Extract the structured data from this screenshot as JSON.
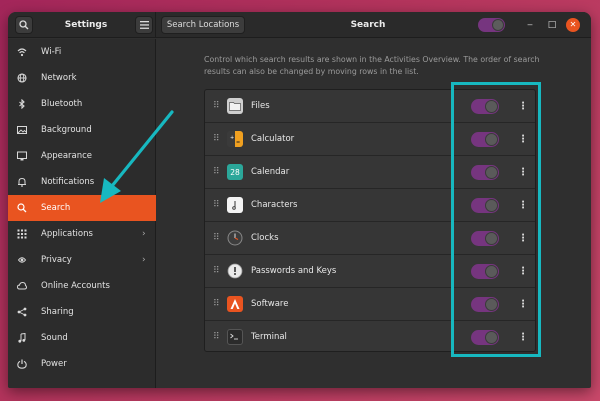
{
  "header": {
    "settings_title": "Settings",
    "search_locations_label": "Search Locations",
    "page_title": "Search",
    "master_switch_on": true,
    "search_icon": "search-icon",
    "menu_icon": "hamburger-menu-icon"
  },
  "sidebar": {
    "items": [
      {
        "label": "Wi-Fi",
        "icon": "wifi-icon",
        "active": false,
        "has_chevron": false
      },
      {
        "label": "Network",
        "icon": "network-icon",
        "active": false,
        "has_chevron": false
      },
      {
        "label": "Bluetooth",
        "icon": "bluetooth-icon",
        "active": false,
        "has_chevron": false
      },
      {
        "label": "Background",
        "icon": "background-icon",
        "active": false,
        "has_chevron": false
      },
      {
        "label": "Appearance",
        "icon": "appearance-icon",
        "active": false,
        "has_chevron": false
      },
      {
        "label": "Notifications",
        "icon": "notifications-icon",
        "active": false,
        "has_chevron": false
      },
      {
        "label": "Search",
        "icon": "search-icon",
        "active": true,
        "has_chevron": false
      },
      {
        "label": "Applications",
        "icon": "applications-icon",
        "active": false,
        "has_chevron": true
      },
      {
        "label": "Privacy",
        "icon": "privacy-icon",
        "active": false,
        "has_chevron": true
      },
      {
        "label": "Online Accounts",
        "icon": "online-accounts-icon",
        "active": false,
        "has_chevron": false
      },
      {
        "label": "Sharing",
        "icon": "sharing-icon",
        "active": false,
        "has_chevron": false
      },
      {
        "label": "Sound",
        "icon": "sound-icon",
        "active": false,
        "has_chevron": false
      },
      {
        "label": "Power",
        "icon": "power-icon",
        "active": false,
        "has_chevron": false
      }
    ]
  },
  "main": {
    "description": "Control which search results are shown in the Activities Overview. The order of search results can also be changed by moving rows in the list.",
    "providers": [
      {
        "name": "Files",
        "icon": "files-icon",
        "enabled": true
      },
      {
        "name": "Calculator",
        "icon": "calculator-icon",
        "enabled": true
      },
      {
        "name": "Calendar",
        "icon": "calendar-icon",
        "enabled": true,
        "icon_text": "28"
      },
      {
        "name": "Characters",
        "icon": "characters-icon",
        "enabled": true
      },
      {
        "name": "Clocks",
        "icon": "clocks-icon",
        "enabled": true
      },
      {
        "name": "Passwords and Keys",
        "icon": "passwords-keys-icon",
        "enabled": true
      },
      {
        "name": "Software",
        "icon": "software-icon",
        "enabled": true
      },
      {
        "name": "Terminal",
        "icon": "terminal-icon",
        "enabled": true
      }
    ]
  },
  "colors": {
    "accent": "#e95420",
    "switch_on": "#76357f",
    "annotation": "#17b8c0",
    "window_bg": "#2f2f2f"
  }
}
